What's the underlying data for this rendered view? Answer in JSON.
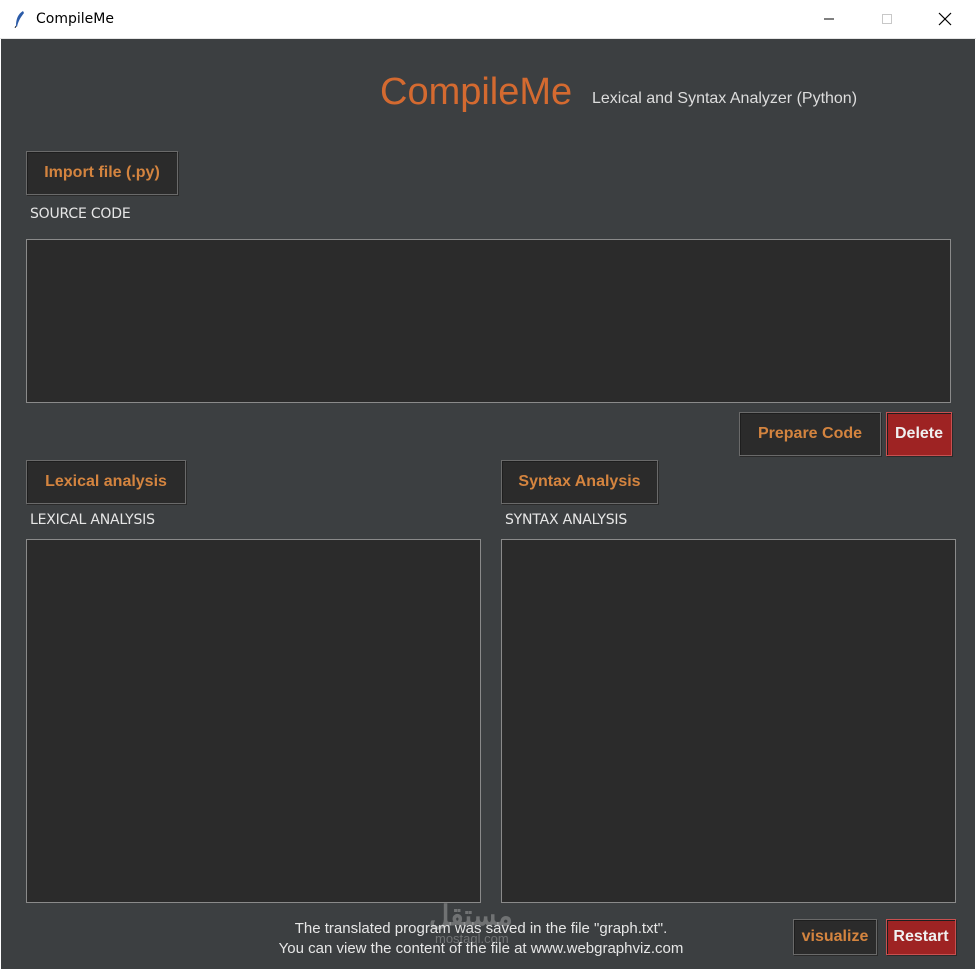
{
  "window": {
    "title": "CompileMe",
    "controls": {
      "minimize": "minimize",
      "maximize": "maximize",
      "close": "close"
    }
  },
  "header": {
    "title": "CompileMe",
    "subtitle": "Lexical and Syntax Analyzer (Python)"
  },
  "source": {
    "import_button": "Import file (.py)",
    "label": "SOURCE CODE",
    "prepare_button": "Prepare Code",
    "delete_button": "Delete"
  },
  "lexical": {
    "button": "Lexical analysis",
    "label": "LEXICAL ANALYSIS"
  },
  "syntax": {
    "button": "Syntax Analysis",
    "label": "SYNTAX ANALYSIS"
  },
  "footer": {
    "line1": "The translated program was saved in the file \"graph.txt\".",
    "line2": "You can view the content of the file at www.webgraphviz.com",
    "visualize_button": "visualize",
    "restart_button": "Restart"
  },
  "watermark": {
    "arabic": "مستقل",
    "latin": "mostaql.com"
  },
  "colors": {
    "background": "#3c3f41",
    "accent": "#d46a30",
    "button_text": "#d4843f",
    "danger": "#9e2323",
    "text_area": "#2b2b2b"
  }
}
